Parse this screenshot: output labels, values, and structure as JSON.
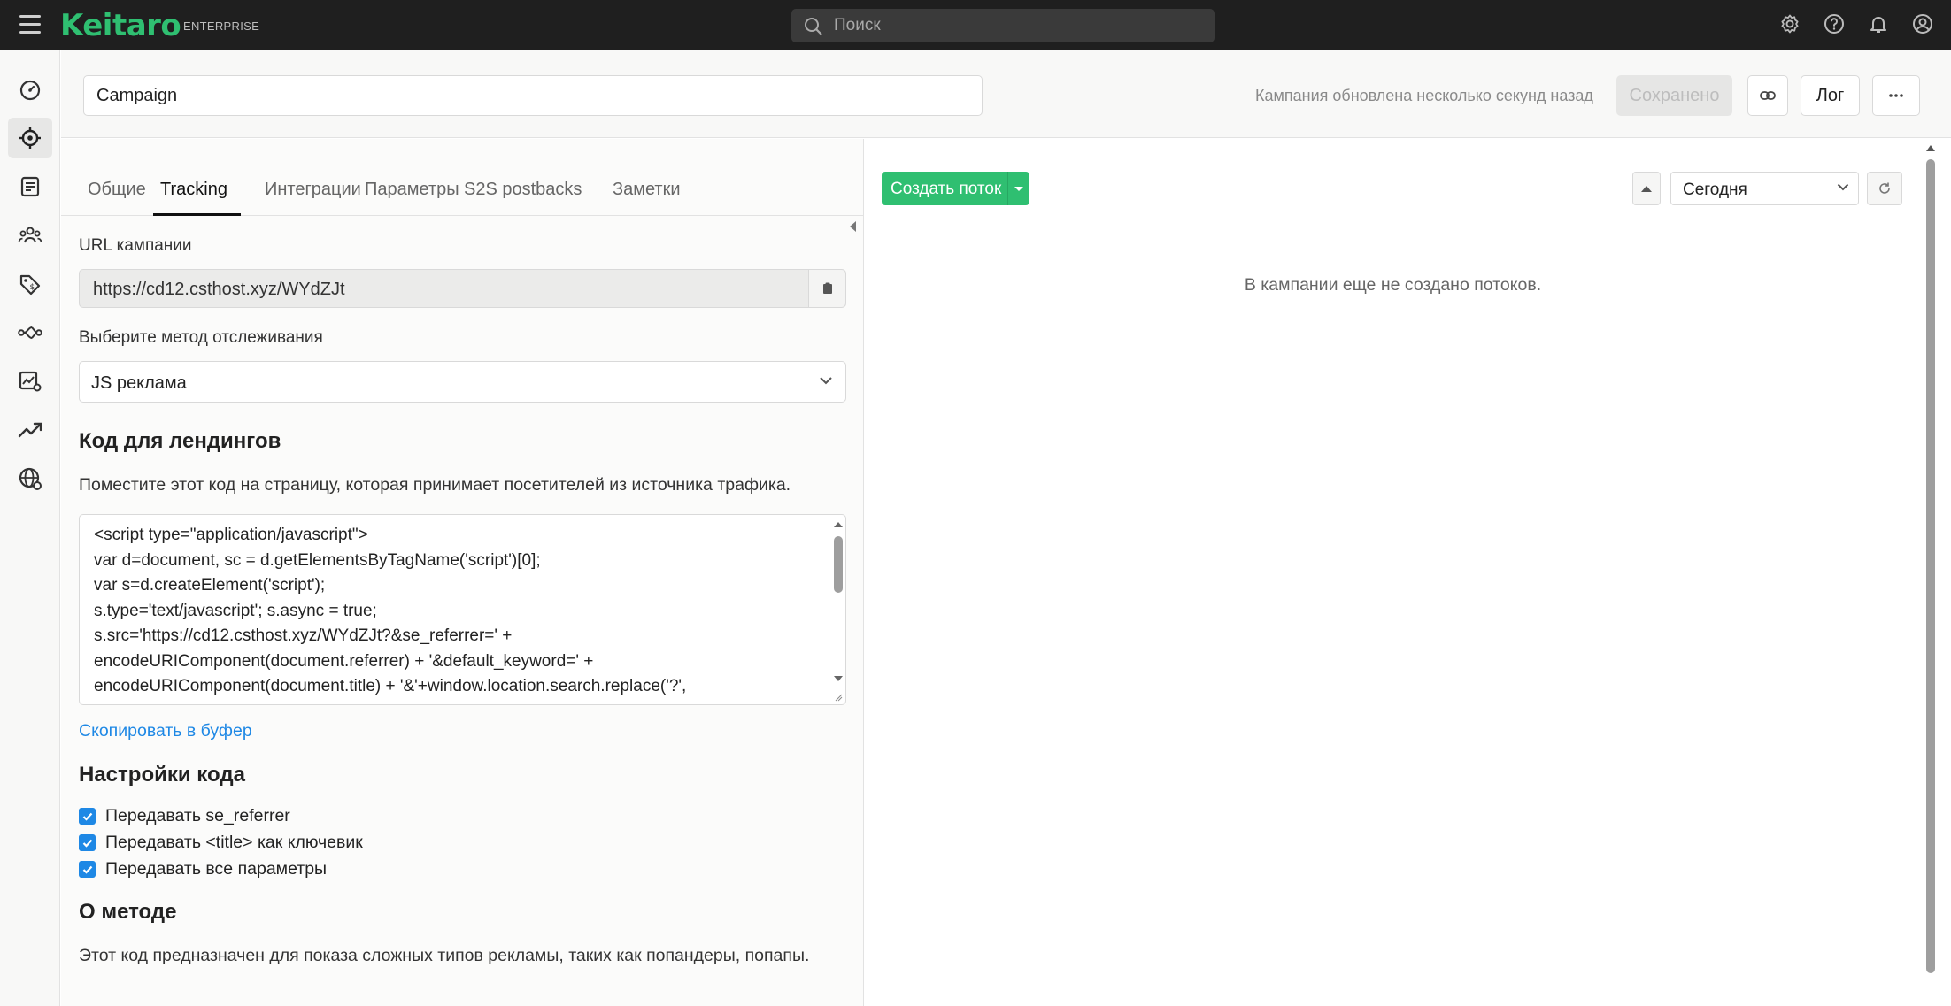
{
  "topbar": {
    "logo": "Keitaro",
    "edition": "ENTERPRISE",
    "search_placeholder": "Поиск"
  },
  "header": {
    "campaign_name": "Campaign",
    "updated_text": "Кампания обновлена несколько секунд назад",
    "saved_label": "Сохранено",
    "log_label": "Лог"
  },
  "tabs": [
    {
      "label": "Общие"
    },
    {
      "label": "Tracking"
    },
    {
      "label": "Интеграции"
    },
    {
      "label": "Параметры"
    },
    {
      "label": "S2S postbacks"
    },
    {
      "label": "Заметки"
    }
  ],
  "tracking": {
    "url_label": "URL кампании",
    "url_value": "https://cd12.csthost.xyz/WYdZJt",
    "method_label": "Выберите метод отслеживания",
    "method_value": "JS реклама",
    "code_heading": "Код для лендингов",
    "code_hint": "Поместите этот код на страницу, которая принимает посетителей из источника трафика.",
    "code": "<script type=\"application/javascript\">\nvar d=document, sc = d.getElementsByTagName('script')[0];\nvar s=d.createElement('script');\ns.type='text/javascript'; s.async = true;\ns.src='https://cd12.csthost.xyz/WYdZJt?&se_referrer=' +\nencodeURIComponent(document.referrer) + '&default_keyword=' +\nencodeURIComponent(document.title) + '&'+window.location.search.replace('?',",
    "copy_link": "Скопировать в буфер",
    "settings_heading": "Настройки кода",
    "checkboxes": [
      {
        "label": "Передавать se_referrer",
        "checked": true
      },
      {
        "label": "Передавать <title> как ключевик",
        "checked": true
      },
      {
        "label": "Передавать все параметры",
        "checked": true
      }
    ],
    "about_heading": "О методе",
    "about_text": "Этот код предназначен для показа сложных типов рекламы, таких как попандеры, попапы."
  },
  "streams": {
    "create_label": "Создать поток",
    "date_value": "Сегодня",
    "empty_text": "В кампании еще не создано потоков."
  },
  "colors": {
    "brand": "#2fbf71",
    "link": "#1e88e5",
    "topbar": "#1f1f1f"
  }
}
